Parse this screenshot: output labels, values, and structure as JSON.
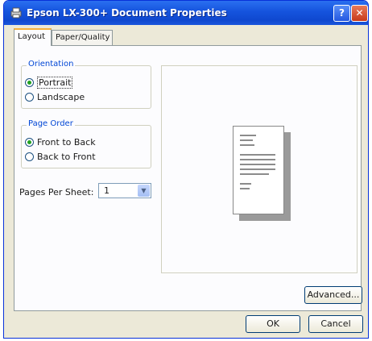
{
  "window": {
    "title": "Epson LX-300+ Document Properties",
    "help_glyph": "?",
    "close_glyph": "✕"
  },
  "tabs": [
    {
      "label": "Layout",
      "active": true
    },
    {
      "label": "Paper/Quality",
      "active": false
    }
  ],
  "orientation": {
    "title": "Orientation",
    "options": [
      {
        "label": "Portrait",
        "checked": true
      },
      {
        "label": "Landscape",
        "checked": false
      }
    ]
  },
  "page_order": {
    "title": "Page Order",
    "options": [
      {
        "label": "Front to Back",
        "checked": true
      },
      {
        "label": "Back to Front",
        "checked": false
      }
    ]
  },
  "pages_per_sheet": {
    "label": "Pages Per Sheet:",
    "value": "1"
  },
  "buttons": {
    "advanced": "Advanced...",
    "ok": "OK",
    "cancel": "Cancel"
  },
  "colors": {
    "titlebar": "#1553dd",
    "group_title": "#0046d5",
    "radio_dot": "#21a121",
    "dialog_bg": "#ece9d8"
  }
}
